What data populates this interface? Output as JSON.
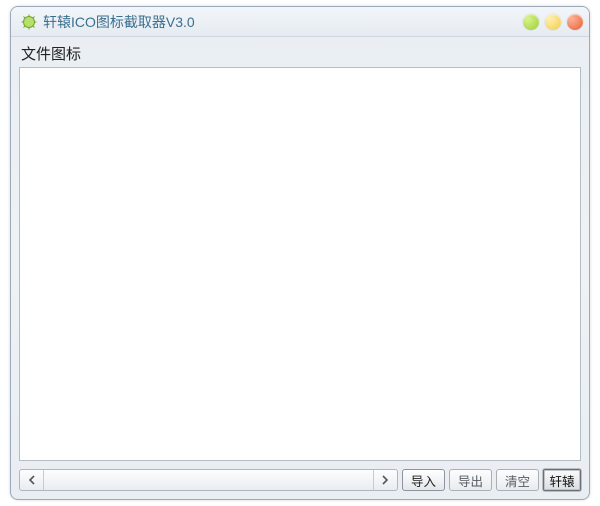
{
  "window": {
    "title": "轩辕ICO图标截取器V3.0"
  },
  "panel": {
    "label": "文件图标"
  },
  "buttons": {
    "import": "导入",
    "export": "导出",
    "clear": "清空",
    "brand": "轩辕"
  }
}
